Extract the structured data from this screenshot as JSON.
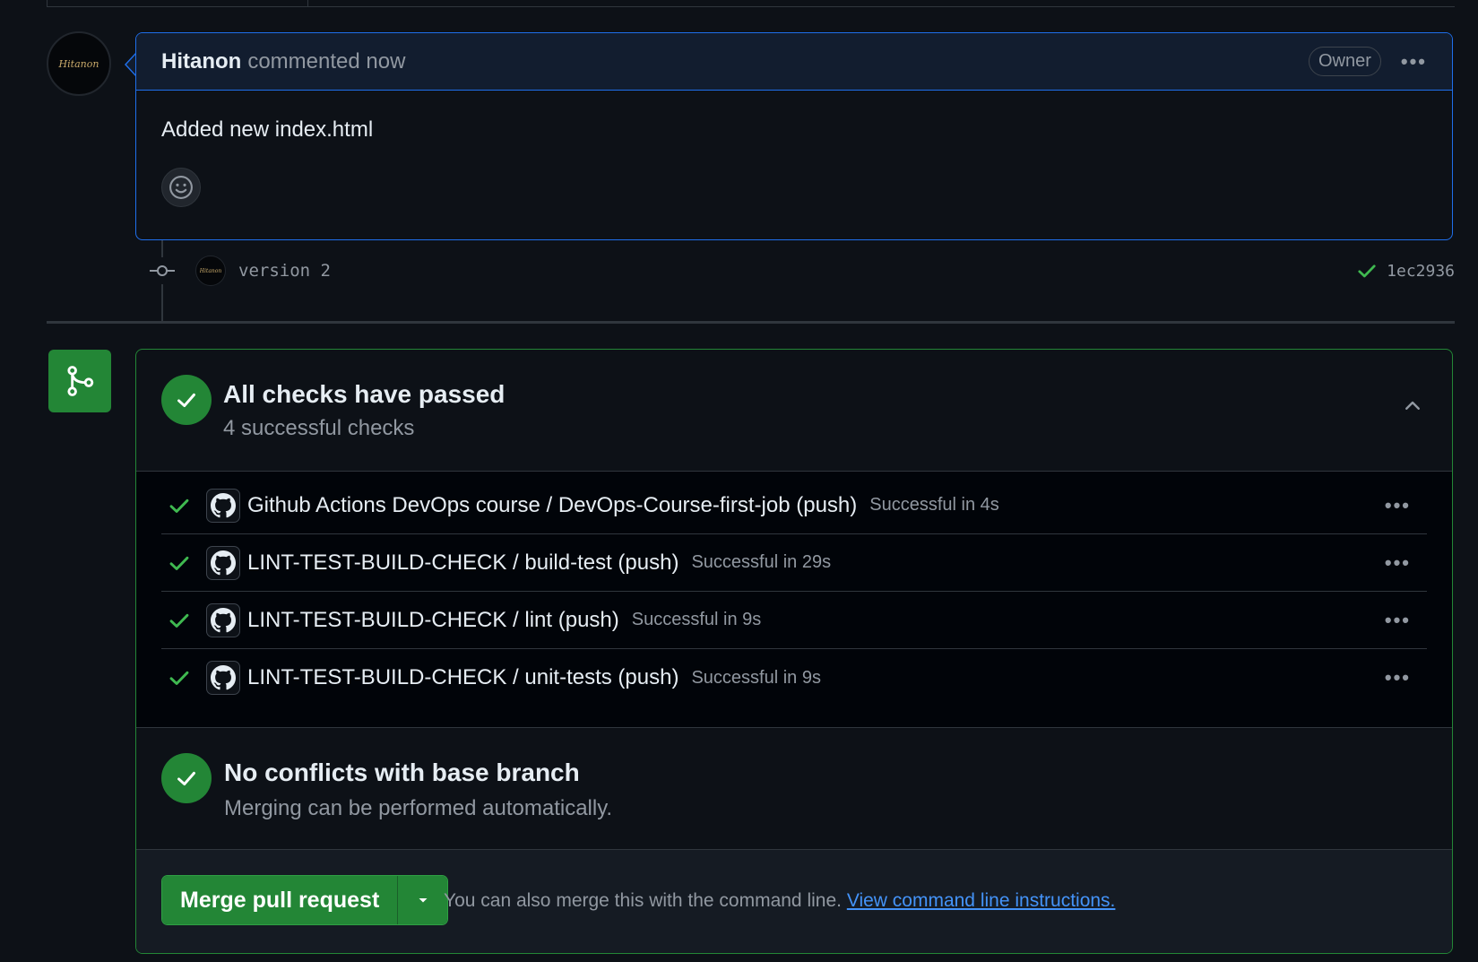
{
  "comment": {
    "author": "Hitanon",
    "action_time": "commented now",
    "role_badge": "Owner",
    "body": "Added new index.html",
    "avatar_text": "Hitanon"
  },
  "commit": {
    "message": "version 2",
    "sha": "1ec2936"
  },
  "checks": {
    "title": "All checks have passed",
    "subtitle": "4 successful checks",
    "items": [
      {
        "name": "Github Actions DevOps course / DevOps-Course-first-job (push)",
        "status": "Successful in 4s"
      },
      {
        "name": "LINT-TEST-BUILD-CHECK / build-test (push)",
        "status": "Successful in 29s"
      },
      {
        "name": "LINT-TEST-BUILD-CHECK / lint (push)",
        "status": "Successful in 9s"
      },
      {
        "name": "LINT-TEST-BUILD-CHECK / unit-tests (push)",
        "status": "Successful in 9s"
      }
    ]
  },
  "conflicts": {
    "title": "No conflicts with base branch",
    "subtitle": "Merging can be performed automatically."
  },
  "merge": {
    "button_label": "Merge pull request",
    "hint_text": "You can also merge this with the command line.",
    "link_text": "View command line instructions."
  },
  "colors": {
    "background": "#0d1117",
    "success": "#238636",
    "accent_blue": "#1f6feb",
    "link": "#4493f8",
    "muted_text": "#9198a1"
  },
  "icons": {
    "comment_menu": "kebab-horizontal-icon",
    "reaction": "smiley-icon",
    "commit": "git-commit-icon",
    "status": "check-icon",
    "merge": "git-merge-icon",
    "collapse": "chevron-up-icon",
    "check_app": "github-mark-icon",
    "dropdown": "triangle-down-icon"
  }
}
